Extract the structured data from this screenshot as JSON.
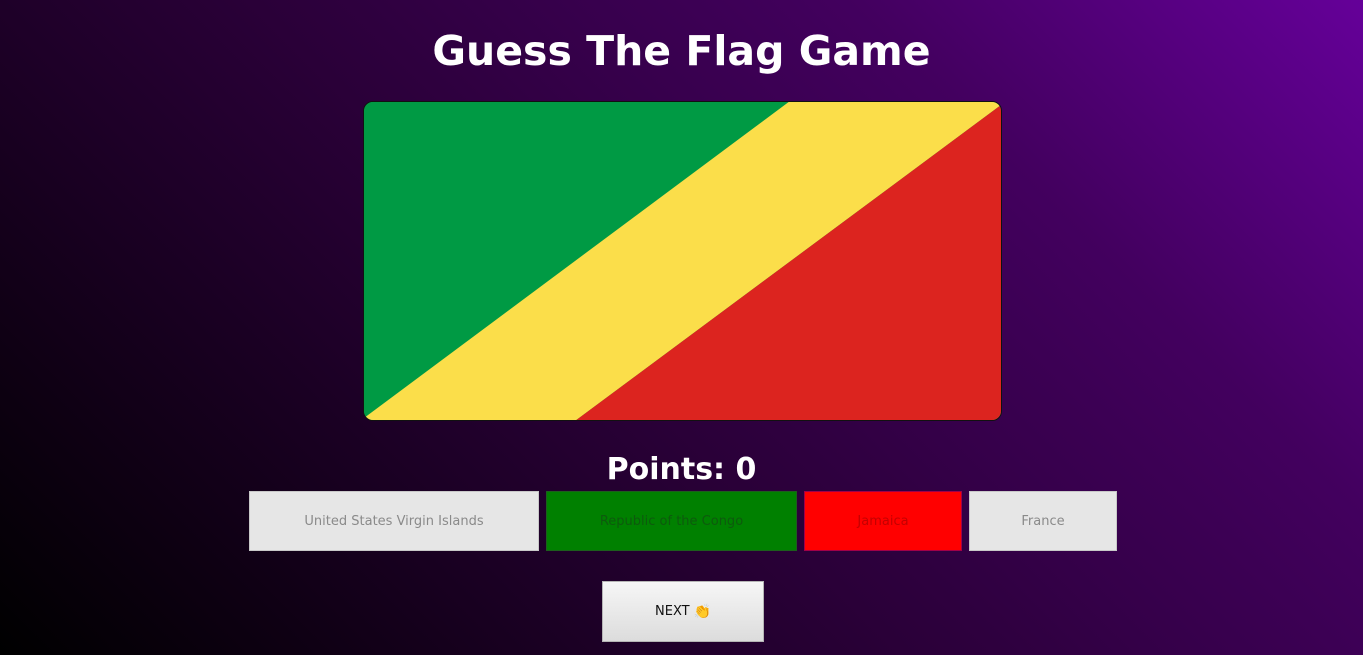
{
  "title": "Guess The Flag Game",
  "flag": {
    "description_icon": "flag-republic-of-the-congo",
    "colors": {
      "green": "#009a44",
      "yellow": "#fbde4a",
      "red": "#dc241f"
    }
  },
  "score": {
    "label": "Points: ",
    "value": "0"
  },
  "options": [
    {
      "label": "United States Virgin Islands",
      "state": "neutral"
    },
    {
      "label": "Republic of the Congo",
      "state": "correct"
    },
    {
      "label": "Jamaica",
      "state": "wrong"
    },
    {
      "label": "France",
      "state": "neutral"
    }
  ],
  "colors": {
    "correct": "#008000",
    "wrong": "#ff0000",
    "neutral": "#e6e6e6",
    "background_dark": "#000000",
    "background_purple": "#650099"
  },
  "next_button": {
    "label": "NEXT",
    "icon": "👏",
    "icon_name": "clapping-hands-icon"
  }
}
